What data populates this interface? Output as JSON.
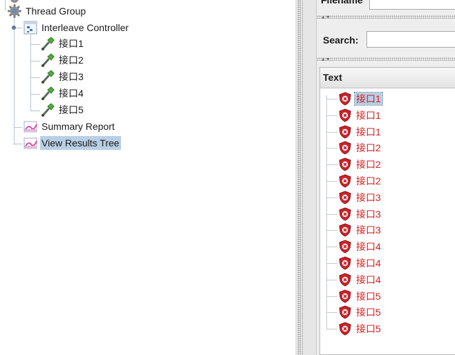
{
  "test_plan": {
    "thread_group": "Thread Group",
    "interleave_controller": "Interleave Controller",
    "samplers": [
      "接口1",
      "接口2",
      "接口3",
      "接口4",
      "接口5"
    ],
    "summary_report": "Summary Report",
    "view_results_tree": "View Results Tree",
    "selected": "View Results Tree"
  },
  "results_panel": {
    "filename_label": "Filename",
    "search_label": "Search:",
    "search_value": "",
    "column_header": "Text",
    "results": [
      {
        "label": "接口1",
        "status": "error"
      },
      {
        "label": "接口1",
        "status": "error"
      },
      {
        "label": "接口1",
        "status": "error"
      },
      {
        "label": "接口2",
        "status": "error"
      },
      {
        "label": "接口2",
        "status": "error"
      },
      {
        "label": "接口2",
        "status": "error"
      },
      {
        "label": "接口3",
        "status": "error"
      },
      {
        "label": "接口3",
        "status": "error"
      },
      {
        "label": "接口3",
        "status": "error"
      },
      {
        "label": "接口4",
        "status": "error"
      },
      {
        "label": "接口4",
        "status": "error"
      },
      {
        "label": "接口4",
        "status": "error"
      },
      {
        "label": "接口5",
        "status": "error"
      },
      {
        "label": "接口5",
        "status": "error"
      },
      {
        "label": "接口5",
        "status": "error"
      }
    ],
    "selected_index": 0
  },
  "colors": {
    "error_text": "#d11f1f",
    "selection": "#b8cfe5",
    "tree_line": "#b7c3d0"
  }
}
